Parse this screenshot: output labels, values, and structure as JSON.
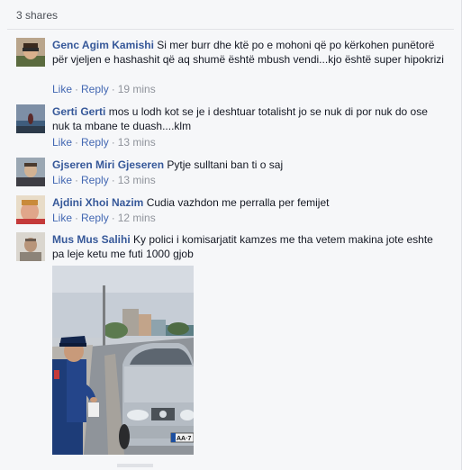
{
  "shares_label": "3 shares",
  "comments": [
    {
      "author": "Genc Agim Kamishi",
      "text": "Si mer burr dhe ktë po e mohoni që po kërkohen punëtorë për vjeljen e hashashit që aq shumë është mbush vendi...kjo është super hipokrizi",
      "like": "Like",
      "reply": "Reply",
      "time": "19 mins"
    },
    {
      "author": "Gerti Gerti",
      "text": "mos u lodh kot se je i deshtuar totalisht jo se nuk di por nuk do ose nuk ta mbane te duash....klm",
      "like": "Like",
      "reply": "Reply",
      "time": "13 mins"
    },
    {
      "author": "Gjseren Miri Gjeseren",
      "text": "Pytje sulltani ban ti o saj",
      "like": "Like",
      "reply": "Reply",
      "time": "13 mins"
    },
    {
      "author": "Ajdini Xhoi Nazim",
      "text": "Cudia vazhdon me perralla per femijet",
      "like": "Like",
      "reply": "Reply",
      "time": "12 mins"
    },
    {
      "author": "Mus Mus Salihi",
      "text": "Ky polici i komisarjatit kamzes me tha vetem makina jote eshte pa leje ketu me futi 1000 gjob"
    }
  ],
  "photo_plate_text": "AA·7"
}
